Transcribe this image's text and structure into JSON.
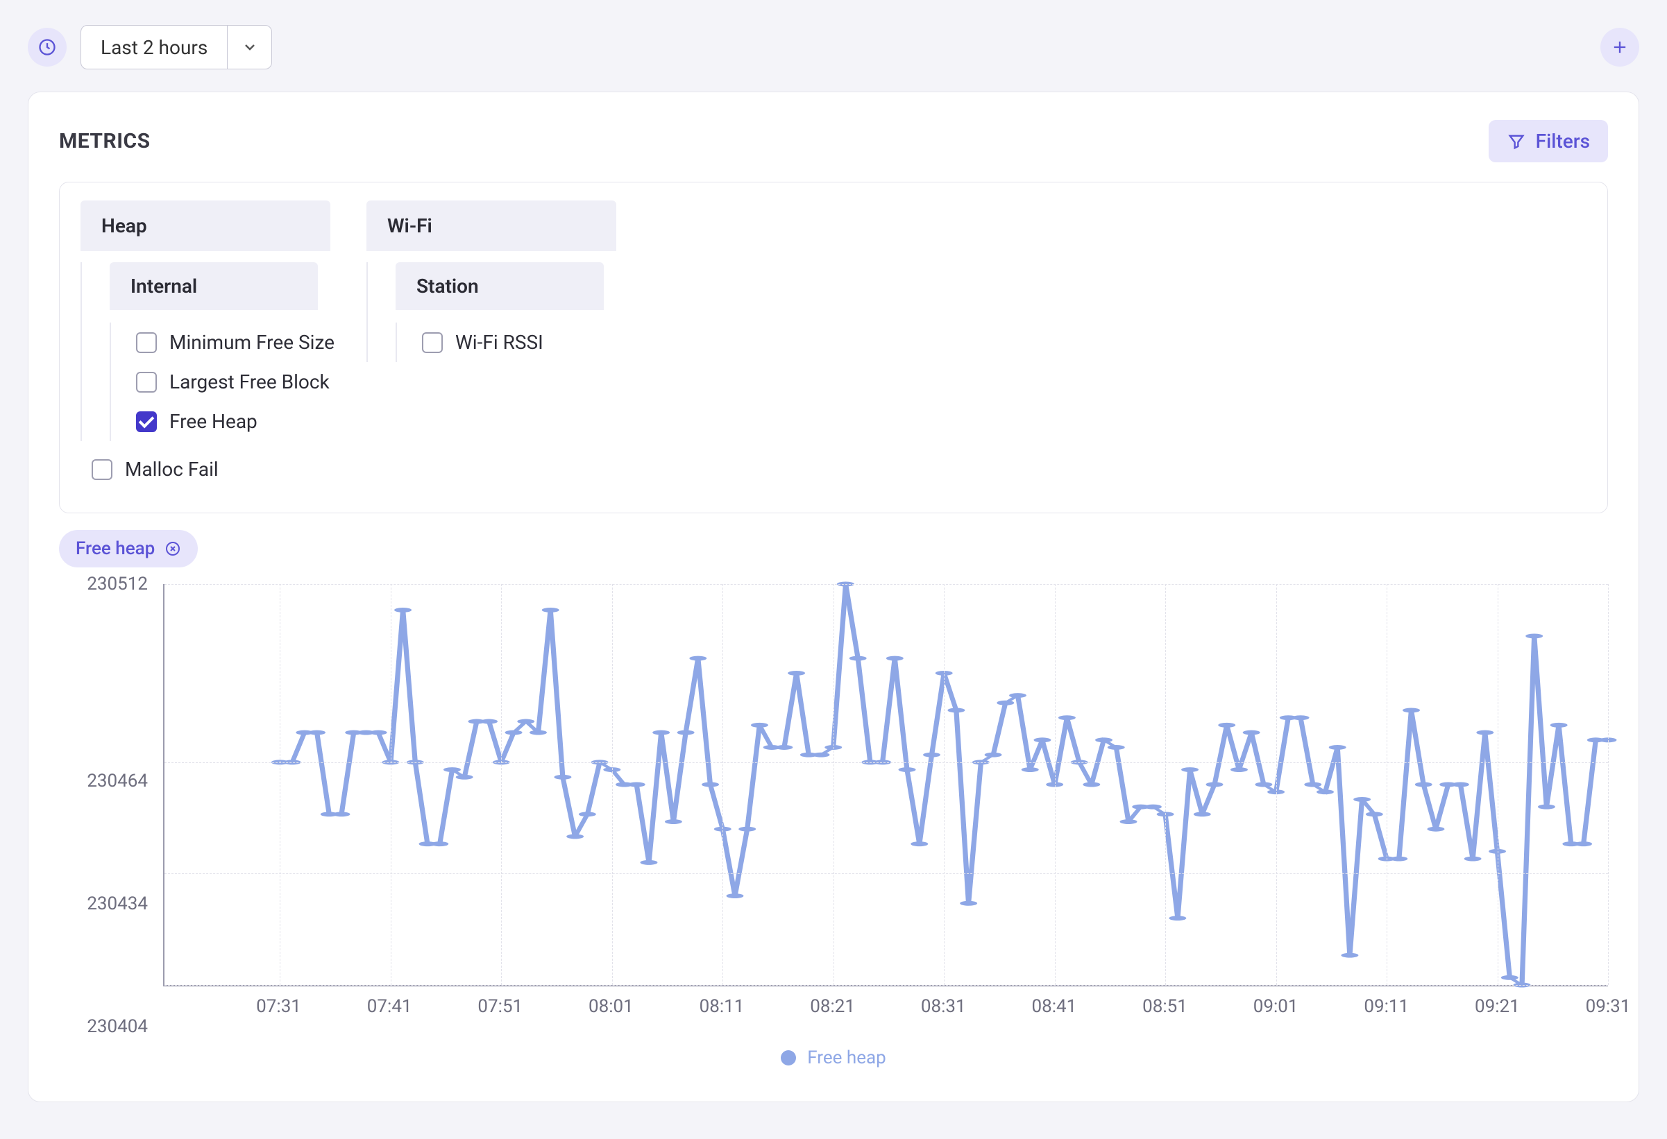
{
  "toolbar": {
    "range_label": "Last 2 hours"
  },
  "card": {
    "title": "METRICS",
    "filters_label": "Filters"
  },
  "tree": {
    "groups": [
      {
        "label": "Heap",
        "subgroups": [
          {
            "label": "Internal",
            "leaves": [
              {
                "label": "Minimum Free Size",
                "checked": false
              },
              {
                "label": "Largest Free Block",
                "checked": false
              },
              {
                "label": "Free Heap",
                "checked": true
              }
            ]
          }
        ],
        "leaves": [
          {
            "label": "Malloc Fail",
            "checked": false
          }
        ]
      },
      {
        "label": "Wi-Fi",
        "subgroups": [
          {
            "label": "Station",
            "leaves": [
              {
                "label": "Wi-Fi RSSI",
                "checked": false
              }
            ]
          }
        ],
        "leaves": []
      }
    ]
  },
  "chips": [
    {
      "label": "Free heap"
    }
  ],
  "chart_data": {
    "type": "line",
    "title": "",
    "xlabel": "",
    "ylabel": "",
    "ylim": [
      230404,
      230512
    ],
    "y_ticks": [
      230512,
      230464,
      230434,
      230404
    ],
    "x_ticks": [
      "07:31",
      "07:41",
      "07:51",
      "08:01",
      "08:11",
      "08:21",
      "08:31",
      "08:41",
      "08:51",
      "09:01",
      "09:11",
      "09:21",
      "09:31"
    ],
    "series": [
      {
        "name": "Free heap",
        "color": "#8ea7e6",
        "values": [
          230464,
          230464,
          230472,
          230472,
          230450,
          230450,
          230472,
          230472,
          230472,
          230464,
          230505,
          230464,
          230442,
          230442,
          230462,
          230460,
          230475,
          230475,
          230464,
          230472,
          230475,
          230472,
          230505,
          230460,
          230444,
          230450,
          230464,
          230462,
          230458,
          230458,
          230437,
          230472,
          230448,
          230472,
          230492,
          230458,
          230446,
          230428,
          230446,
          230474,
          230468,
          230468,
          230488,
          230466,
          230466,
          230468,
          230512,
          230492,
          230464,
          230464,
          230492,
          230462,
          230442,
          230466,
          230488,
          230478,
          230426,
          230464,
          230466,
          230480,
          230482,
          230462,
          230470,
          230458,
          230476,
          230464,
          230458,
          230470,
          230468,
          230448,
          230452,
          230452,
          230450,
          230422,
          230462,
          230450,
          230458,
          230474,
          230462,
          230472,
          230458,
          230456,
          230476,
          230476,
          230458,
          230456,
          230468,
          230412,
          230454,
          230450,
          230438,
          230438,
          230478,
          230458,
          230446,
          230458,
          230458,
          230438,
          230472,
          230440,
          230406,
          230404,
          230498,
          230452,
          230474,
          230442,
          230442,
          230470,
          230470
        ]
      }
    ]
  },
  "legend": {
    "label": "Free heap"
  }
}
